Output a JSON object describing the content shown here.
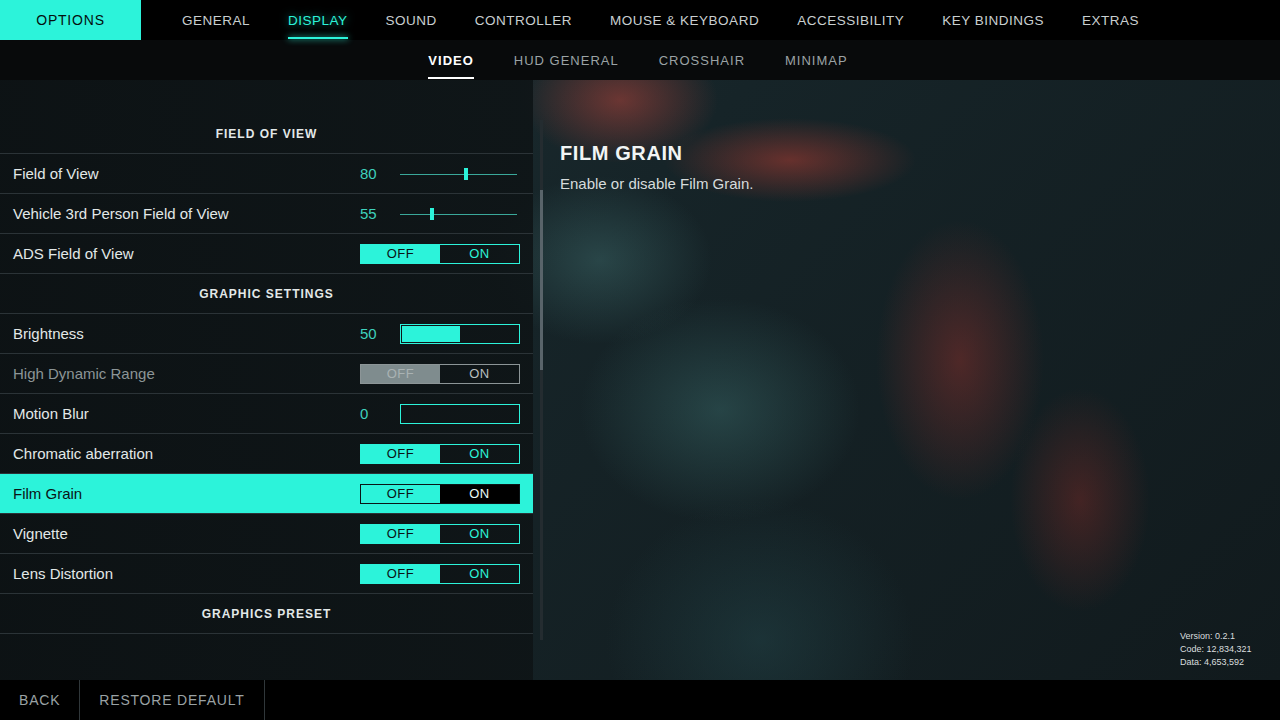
{
  "title": "OPTIONS",
  "tabs": [
    {
      "label": "GENERAL",
      "selected": false
    },
    {
      "label": "DISPLAY",
      "selected": true
    },
    {
      "label": "SOUND",
      "selected": false
    },
    {
      "label": "CONTROLLER",
      "selected": false
    },
    {
      "label": "MOUSE & KEYBOARD",
      "selected": false
    },
    {
      "label": "ACCESSIBILITY",
      "selected": false
    },
    {
      "label": "KEY BINDINGS",
      "selected": false
    },
    {
      "label": "EXTRAS",
      "selected": false
    }
  ],
  "subtabs": [
    {
      "label": "VIDEO",
      "selected": true
    },
    {
      "label": "HUD GENERAL",
      "selected": false
    },
    {
      "label": "CROSSHAIR",
      "selected": false
    },
    {
      "label": "MINIMAP",
      "selected": false
    }
  ],
  "sections": [
    {
      "title": "FIELD OF VIEW",
      "rows": [
        {
          "label": "Field of View",
          "kind": "slider",
          "value": "80",
          "level": 0.565,
          "selected": false,
          "disabled": false
        },
        {
          "label": "Vehicle 3rd Person Field of View",
          "kind": "slider",
          "value": "55",
          "level": 0.27,
          "selected": false,
          "disabled": false
        },
        {
          "label": "ADS Field of View",
          "kind": "toggle",
          "options": [
            {
              "label": "OFF",
              "selected": true
            },
            {
              "label": "ON",
              "selected": false
            }
          ],
          "selected": false,
          "disabled": false
        }
      ]
    },
    {
      "title": "GRAPHIC SETTINGS",
      "rows": [
        {
          "label": "Brightness",
          "kind": "bar",
          "value": "50",
          "level": 0.5,
          "selected": false,
          "disabled": false
        },
        {
          "label": "High Dynamic Range",
          "kind": "toggle",
          "options": [
            {
              "label": "OFF",
              "selected": true
            },
            {
              "label": "ON",
              "selected": false
            }
          ],
          "selected": false,
          "disabled": true
        },
        {
          "label": "Motion Blur",
          "kind": "bar",
          "value": "0",
          "level": 0,
          "selected": false,
          "disabled": false
        },
        {
          "label": "Chromatic aberration",
          "kind": "toggle",
          "options": [
            {
              "label": "OFF",
              "selected": true
            },
            {
              "label": "ON",
              "selected": false
            }
          ],
          "selected": false,
          "disabled": false
        },
        {
          "label": "Film Grain",
          "kind": "toggle",
          "options": [
            {
              "label": "OFF",
              "selected": true
            },
            {
              "label": "ON",
              "selected": false
            }
          ],
          "selected": true,
          "disabled": false
        },
        {
          "label": "Vignette",
          "kind": "toggle",
          "options": [
            {
              "label": "OFF",
              "selected": true
            },
            {
              "label": "ON",
              "selected": false
            }
          ],
          "selected": false,
          "disabled": false
        },
        {
          "label": "Lens Distortion",
          "kind": "toggle",
          "options": [
            {
              "label": "OFF",
              "selected": true
            },
            {
              "label": "ON",
              "selected": false
            }
          ],
          "selected": false,
          "disabled": false
        }
      ]
    },
    {
      "title": "GRAPHICS PRESET",
      "rows": []
    }
  ],
  "detail": {
    "title": "FILM GRAIN",
    "description": "Enable or disable Film Grain."
  },
  "version": [
    "Version: 0.2.1",
    "Code: 12,834,321",
    "Data: 4,653,592"
  ],
  "footer": [
    "BACK",
    "RESTORE DEFAULT"
  ]
}
